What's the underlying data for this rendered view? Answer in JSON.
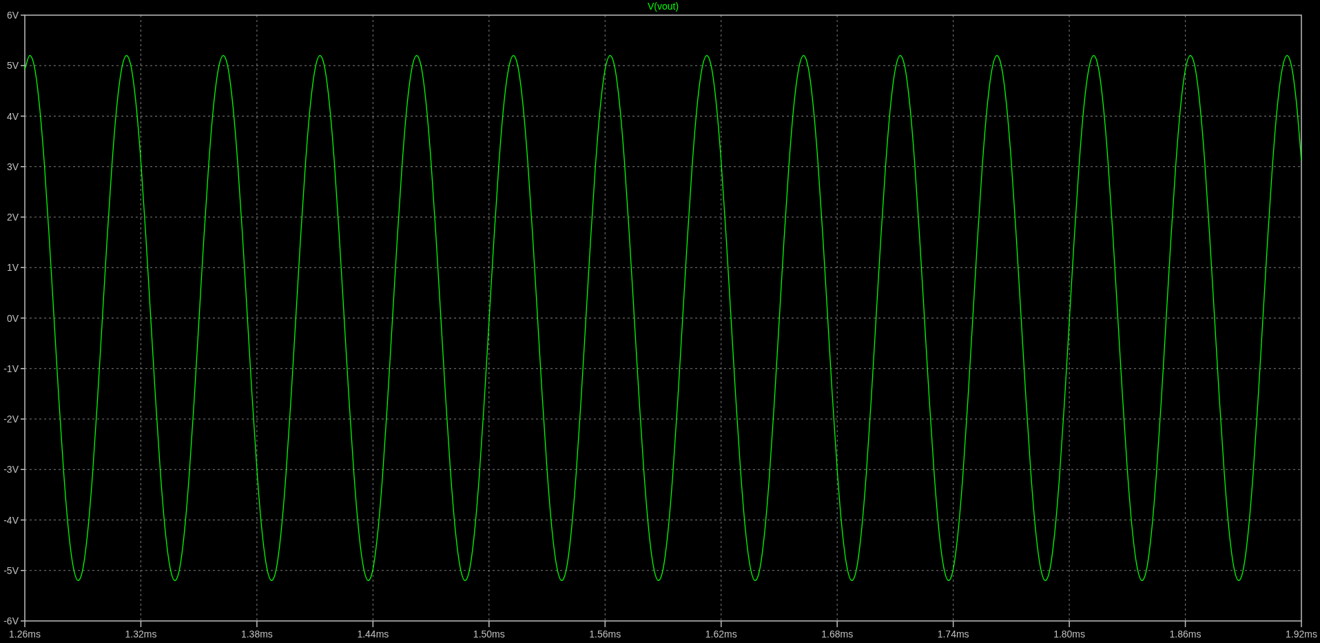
{
  "plot": {
    "chart_data": {
      "type": "line",
      "grid": true,
      "xlim": [
        1.26,
        1.92
      ],
      "ylim": [
        -6,
        6
      ],
      "xticks": [
        {
          "value": 1.26,
          "label": "1.26ms"
        },
        {
          "value": 1.32,
          "label": "1.32ms"
        },
        {
          "value": 1.38,
          "label": "1.38ms"
        },
        {
          "value": 1.44,
          "label": "1.44ms"
        },
        {
          "value": 1.5,
          "label": "1.50ms"
        },
        {
          "value": 1.56,
          "label": "1.56ms"
        },
        {
          "value": 1.62,
          "label": "1.62ms"
        },
        {
          "value": 1.68,
          "label": "1.68ms"
        },
        {
          "value": 1.74,
          "label": "1.74ms"
        },
        {
          "value": 1.8,
          "label": "1.80ms"
        },
        {
          "value": 1.86,
          "label": "1.86ms"
        },
        {
          "value": 1.92,
          "label": "1.92ms"
        }
      ],
      "yticks": [
        {
          "value": 6,
          "label": "6V"
        },
        {
          "value": 5,
          "label": "5V"
        },
        {
          "value": 4,
          "label": "4V"
        },
        {
          "value": 3,
          "label": "3V"
        },
        {
          "value": 2,
          "label": "2V"
        },
        {
          "value": 1,
          "label": "1V"
        },
        {
          "value": 0,
          "label": "0V"
        },
        {
          "value": -1,
          "label": "-1V"
        },
        {
          "value": -2,
          "label": "-2V"
        },
        {
          "value": -3,
          "label": "-3V"
        },
        {
          "value": -4,
          "label": "-4V"
        },
        {
          "value": -5,
          "label": "-5V"
        },
        {
          "value": -6,
          "label": "-6V"
        }
      ],
      "x": [
        1.26,
        1.2625,
        1.265,
        1.2675,
        1.27,
        1.2725,
        1.275,
        1.2775,
        1.28,
        1.2825,
        1.285,
        1.2875,
        1.29,
        1.2925,
        1.295,
        1.2975,
        1.3,
        1.3025,
        1.305,
        1.3075,
        1.31,
        1.3125,
        1.315,
        1.3175,
        1.32,
        1.3225,
        1.325,
        1.3275,
        1.33,
        1.3325,
        1.335,
        1.3375,
        1.34,
        1.3425,
        1.345,
        1.3475,
        1.35,
        1.3525,
        1.355,
        1.3575,
        1.36,
        1.3625,
        1.365,
        1.3675,
        1.37,
        1.3725,
        1.375,
        1.3775,
        1.38,
        1.3825,
        1.385,
        1.3875,
        1.39,
        1.3925,
        1.395,
        1.3975,
        1.4,
        1.4025,
        1.405,
        1.4075,
        1.41,
        1.4125,
        1.415,
        1.4175,
        1.42,
        1.4225,
        1.425,
        1.4275,
        1.43,
        1.4325,
        1.435,
        1.4375,
        1.44,
        1.4425,
        1.445,
        1.4475,
        1.45,
        1.4525,
        1.455,
        1.4575,
        1.46,
        1.4625,
        1.465,
        1.4675,
        1.47,
        1.4725,
        1.475,
        1.4775,
        1.48,
        1.4825,
        1.485,
        1.4875,
        1.49,
        1.4925,
        1.495,
        1.4975,
        1.5,
        1.5025,
        1.505,
        1.5075,
        1.51,
        1.5125,
        1.515,
        1.5175,
        1.52,
        1.5225,
        1.525,
        1.5275,
        1.53,
        1.5325,
        1.535,
        1.5375,
        1.54,
        1.5425,
        1.545,
        1.5475,
        1.55,
        1.5525,
        1.555,
        1.5575,
        1.56,
        1.5625,
        1.565,
        1.5675,
        1.57,
        1.5725,
        1.575,
        1.5775,
        1.58,
        1.5825,
        1.585,
        1.5875,
        1.59,
        1.5925,
        1.595,
        1.5975,
        1.6,
        1.6025,
        1.605,
        1.6075,
        1.61,
        1.6125,
        1.615,
        1.6175,
        1.62,
        1.6225,
        1.625,
        1.6275,
        1.63,
        1.6325,
        1.635,
        1.6375,
        1.64,
        1.6425,
        1.645,
        1.6475,
        1.65,
        1.6525,
        1.655,
        1.6575,
        1.66,
        1.6625,
        1.665,
        1.6675,
        1.67,
        1.6725,
        1.675,
        1.6775,
        1.68,
        1.6825,
        1.685,
        1.6875,
        1.69,
        1.6925,
        1.695,
        1.6975,
        1.7,
        1.7025,
        1.705,
        1.7075,
        1.71,
        1.7125,
        1.715,
        1.7175,
        1.72,
        1.7225,
        1.725,
        1.7275,
        1.73,
        1.7325,
        1.735,
        1.7375,
        1.74,
        1.7425,
        1.745,
        1.7475,
        1.75,
        1.7525,
        1.755,
        1.7575,
        1.76,
        1.7625,
        1.765,
        1.7675,
        1.77,
        1.7725,
        1.775,
        1.7775,
        1.78,
        1.7825,
        1.785,
        1.7875,
        1.79,
        1.7925,
        1.795,
        1.7975,
        1.8,
        1.8025,
        1.805,
        1.8075,
        1.81,
        1.8125,
        1.815,
        1.8175,
        1.82,
        1.8225,
        1.825,
        1.8275,
        1.83,
        1.8325,
        1.835,
        1.8375,
        1.84,
        1.8425,
        1.845,
        1.8475,
        1.85,
        1.8525,
        1.855,
        1.8575,
        1.86,
        1.8625,
        1.865,
        1.8675,
        1.87,
        1.8725,
        1.875,
        1.8775,
        1.88,
        1.8825,
        1.885,
        1.8875,
        1.89,
        1.8925,
        1.895,
        1.8975,
        1.9,
        1.9025,
        1.905,
        1.9075,
        1.91,
        1.9125,
        1.915,
        1.9175,
        1.92
      ],
      "series": [
        {
          "name": "V(vout)",
          "color": "#00ff00",
          "values": [
            4.92,
            5.2,
            4.97,
            4.24,
            3.11,
            1.67,
            0.07,
            -1.54,
            -3,
            -4.17,
            -4.92,
            -5.2,
            -4.97,
            -4.24,
            -3.11,
            -1.67,
            -0.07,
            1.54,
            3,
            4.17,
            4.92,
            5.2,
            4.97,
            4.24,
            3.11,
            1.67,
            0.07,
            -1.54,
            -3,
            -4.17,
            -4.92,
            -5.2,
            -4.97,
            -4.24,
            -3.11,
            -1.67,
            -0.07,
            1.54,
            3,
            4.17,
            4.92,
            5.2,
            4.97,
            4.24,
            3.11,
            1.67,
            0.07,
            -1.54,
            -3,
            -4.17,
            -4.92,
            -5.2,
            -4.97,
            -4.24,
            -3.11,
            -1.67,
            -0.07,
            1.54,
            3,
            4.17,
            4.92,
            5.2,
            4.97,
            4.24,
            3.11,
            1.67,
            0.07,
            -1.54,
            -3,
            -4.17,
            -4.92,
            -5.2,
            -4.97,
            -4.24,
            -3.11,
            -1.67,
            -0.07,
            1.54,
            3,
            4.17,
            4.92,
            5.2,
            4.97,
            4.24,
            3.11,
            1.67,
            0.07,
            -1.54,
            -3,
            -4.17,
            -4.92,
            -5.2,
            -4.97,
            -4.24,
            -3.11,
            -1.67,
            -0.07,
            1.54,
            3,
            4.17,
            4.92,
            5.2,
            4.97,
            4.24,
            3.11,
            1.67,
            0.07,
            -1.54,
            -3,
            -4.17,
            -4.92,
            -5.2,
            -4.97,
            -4.24,
            -3.11,
            -1.67,
            -0.07,
            1.54,
            3,
            4.17,
            4.92,
            5.2,
            4.97,
            4.24,
            3.11,
            1.67,
            0.07,
            -1.54,
            -3,
            -4.17,
            -4.92,
            -5.2,
            -4.97,
            -4.24,
            -3.11,
            -1.67,
            -0.07,
            1.54,
            3,
            4.17,
            4.92,
            5.2,
            4.97,
            4.24,
            3.11,
            1.67,
            0.07,
            -1.54,
            -3,
            -4.17,
            -4.92,
            -5.2,
            -4.97,
            -4.24,
            -3.11,
            -1.67,
            -0.07,
            1.54,
            3,
            4.17,
            4.92,
            5.2,
            4.97,
            4.24,
            3.11,
            1.67,
            0.07,
            -1.54,
            -3,
            -4.17,
            -4.92,
            -5.2,
            -4.97,
            -4.24,
            -3.11,
            -1.67,
            -0.07,
            1.54,
            3,
            4.17,
            4.92,
            5.2,
            4.97,
            4.24,
            3.11,
            1.67,
            0.07,
            -1.54,
            -3,
            -4.17,
            -4.92,
            -5.2,
            -4.97,
            -4.24,
            -3.11,
            -1.67,
            -0.07,
            1.54,
            3,
            4.17,
            4.92,
            5.2,
            4.97,
            4.24,
            3.11,
            1.67,
            0.07,
            -1.54,
            -3,
            -4.17,
            -4.92,
            -5.2,
            -4.97,
            -4.24,
            -3.11,
            -1.67,
            -0.07,
            1.54,
            3,
            4.17,
            4.92,
            5.2,
            4.97,
            4.24,
            3.11,
            1.67,
            0.07,
            -1.54,
            -3,
            -4.17,
            -4.92,
            -5.2,
            -4.97,
            -4.24,
            -3.11,
            -1.67,
            -0.07,
            1.54,
            3,
            4.17,
            4.92,
            5.2,
            4.97,
            4.24,
            3.11,
            1.67,
            0.07,
            -1.54,
            -3,
            -4.17,
            -4.92,
            -5.2,
            -4.97,
            -4.24,
            -3.11,
            -1.67,
            -0.07,
            1.54,
            3,
            4.17,
            4.92,
            5.2,
            4.97,
            4.24,
            3.11
          ]
        }
      ]
    }
  }
}
